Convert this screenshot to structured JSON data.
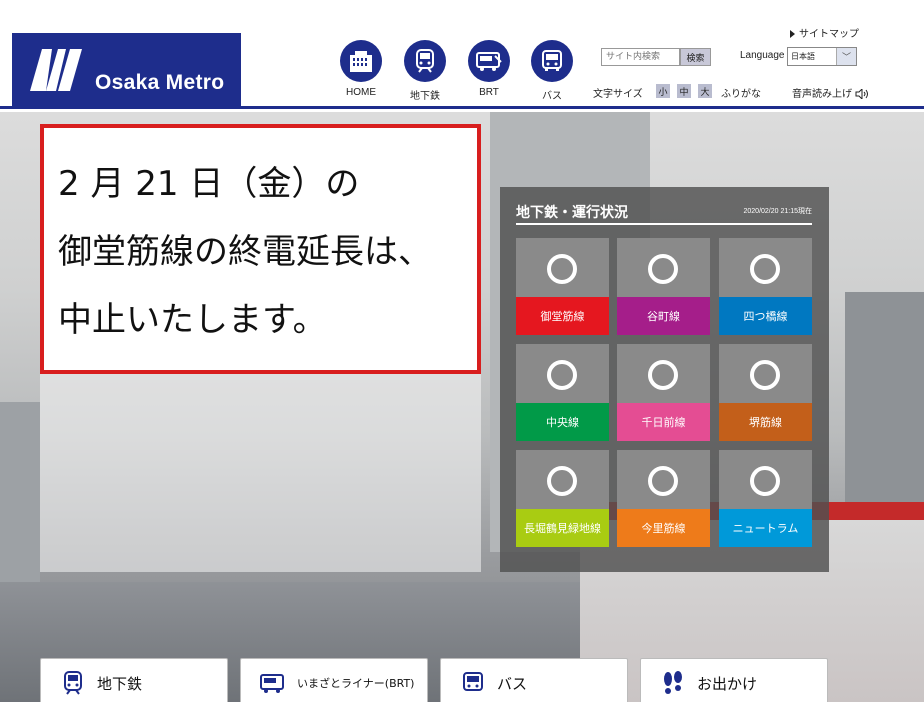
{
  "header": {
    "logo_text": "Osaka Metro",
    "nav": [
      {
        "label": "HOME",
        "icon": "building-icon"
      },
      {
        "label": "地下鉄",
        "icon": "train-icon"
      },
      {
        "label": "BRT",
        "icon": "brt-bus-icon"
      },
      {
        "label": "バス",
        "icon": "bus-icon"
      }
    ],
    "sitemap": "サイトマップ",
    "search": {
      "placeholder": "サイト内検索",
      "button": "検索"
    },
    "language": {
      "label": "Language",
      "selected": "日本語"
    },
    "font_size": {
      "label": "文字サイズ",
      "small": "小",
      "medium": "中",
      "large": "大"
    },
    "furigana": "ふりがな",
    "read_aloud": "音声読み上げ"
  },
  "notice": {
    "lines": [
      "2 月 21 日（金）の",
      "御堂筋線の終電延長は、",
      "中止いたします。"
    ]
  },
  "status": {
    "title": "地下鉄・運行状況",
    "timestamp": "2020/02/20 21:15現在",
    "lines": [
      {
        "name": "御堂筋線",
        "color": "#e5171f"
      },
      {
        "name": "谷町線",
        "color": "#a51e8a"
      },
      {
        "name": "四つ橋線",
        "color": "#0078c1"
      },
      {
        "name": "中央線",
        "color": "#019a48"
      },
      {
        "name": "千日前線",
        "color": "#e44d93"
      },
      {
        "name": "堺筋線",
        "color": "#c35f1a"
      },
      {
        "name": "長堀鶴見緑地線",
        "color": "#a9cc12"
      },
      {
        "name": "今里筋線",
        "color": "#ee7b1a"
      },
      {
        "name": "ニュートラム",
        "color": "#0099d9"
      }
    ]
  },
  "cards": [
    {
      "label": "地下鉄",
      "icon": "train-icon"
    },
    {
      "label": "いまざとライナー(BRT)",
      "icon": "brt-bus-icon"
    },
    {
      "label": "バス",
      "icon": "bus-icon"
    },
    {
      "label": "お出かけ",
      "icon": "footprints-icon"
    }
  ],
  "colors": {
    "brand": "#1e2d8c",
    "notice_border": "#d81e1e"
  }
}
